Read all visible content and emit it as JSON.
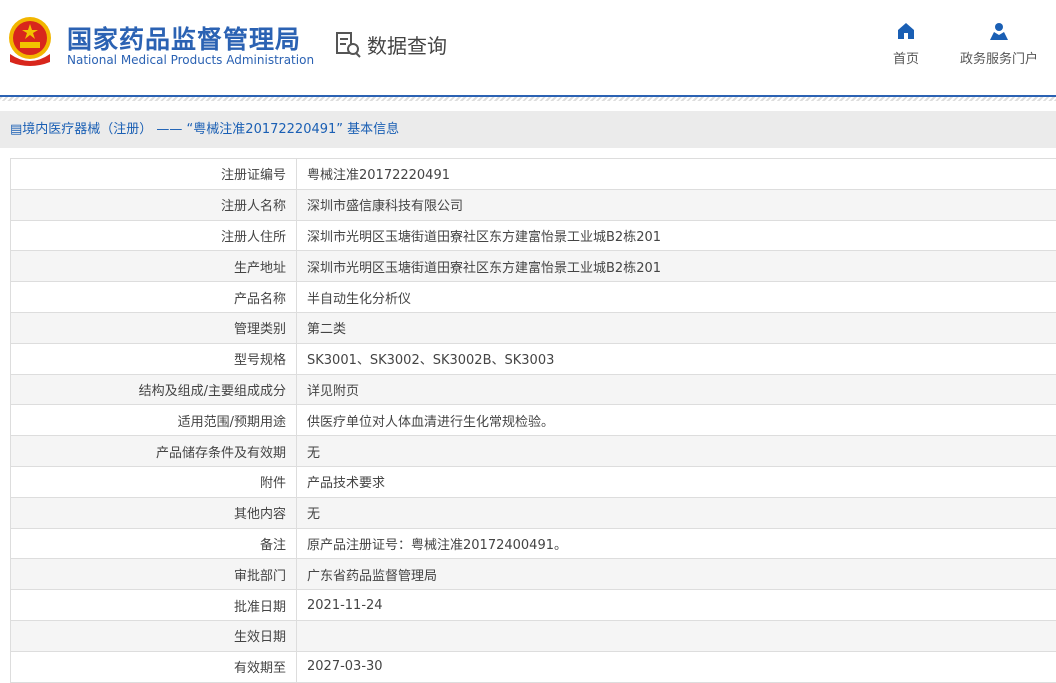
{
  "header": {
    "title_cn": "国家药品监督管理局",
    "title_en": "National Medical Products Administration",
    "section": "数据查询",
    "nav": [
      {
        "label": "首页",
        "icon": "home-icon"
      },
      {
        "label": "政务服务门户",
        "icon": "user-icon"
      }
    ]
  },
  "breadcrumb": "境内医疗器械（注册） —— “粤械注准20172220491” 基本信息",
  "rows": [
    {
      "label": "注册证编号",
      "value": "粤械注准20172220491"
    },
    {
      "label": "注册人名称",
      "value": "深圳市盛信康科技有限公司"
    },
    {
      "label": "注册人住所",
      "value": "深圳市光明区玉塘街道田寮社区东方建富怡景工业城B2栋201"
    },
    {
      "label": "生产地址",
      "value": "深圳市光明区玉塘街道田寮社区东方建富怡景工业城B2栋201"
    },
    {
      "label": "产品名称",
      "value": "半自动生化分析仪"
    },
    {
      "label": "管理类别",
      "value": "第二类"
    },
    {
      "label": "型号规格",
      "value": "SK3001、SK3002、SK3002B、SK3003"
    },
    {
      "label": "结构及组成/主要组成成分",
      "value": "详见附页"
    },
    {
      "label": "适用范围/预期用途",
      "value": "供医疗单位对人体血清进行生化常规检验。"
    },
    {
      "label": "产品储存条件及有效期",
      "value": "无"
    },
    {
      "label": "附件",
      "value": "产品技术要求"
    },
    {
      "label": "其他内容",
      "value": "无"
    },
    {
      "label": "备注",
      "value": "原产品注册证号：粤械注准20172400491。"
    },
    {
      "label": "审批部门",
      "value": "广东省药品监督管理局"
    },
    {
      "label": "批准日期",
      "value": "2021-11-24"
    },
    {
      "label": "生效日期",
      "value": ""
    },
    {
      "label": "有效期至",
      "value": "2027-03-30"
    }
  ]
}
